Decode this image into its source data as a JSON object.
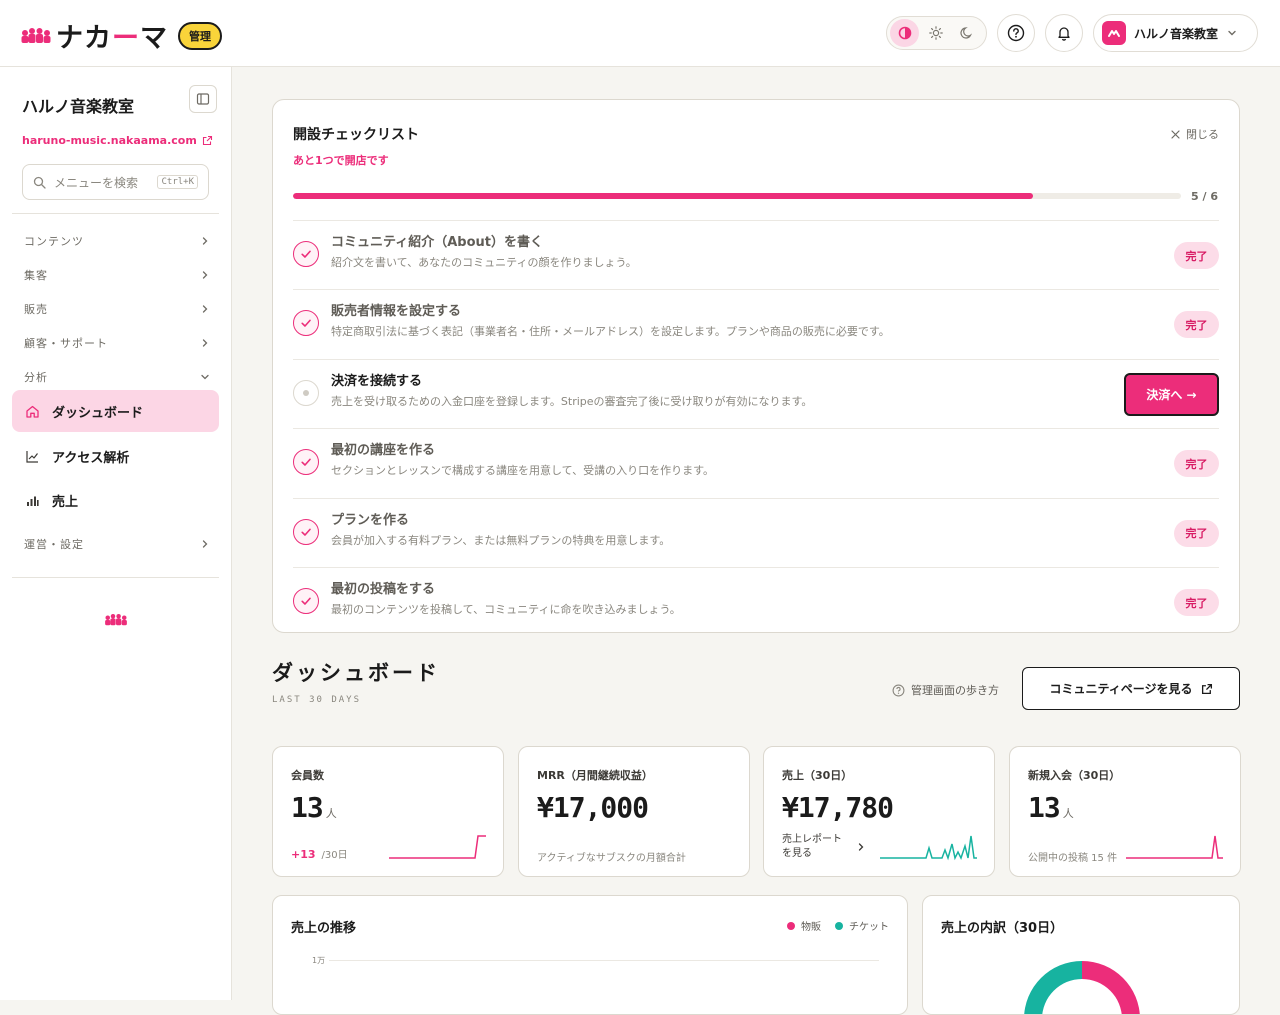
{
  "header": {
    "brand_wordmark_a": "ナカ",
    "brand_wordmark_dash": "ー",
    "brand_wordmark_b": "マ",
    "admin_badge": "管理",
    "account_name": "ハルノ音楽教室",
    "colors": {
      "accent": "#ec2d7a",
      "badge": "#f9d43a"
    },
    "icons": [
      "contrast-icon",
      "sun-icon",
      "moon-icon",
      "help-icon",
      "bell-icon",
      "chevron-down-icon"
    ]
  },
  "sidebar": {
    "title": "ハルノ音楽教室",
    "url": "haruno-music.nakaama.com",
    "search_placeholder": "メニューを検索",
    "search_shortcut": "Ctrl+K",
    "groups": {
      "content": "コンテンツ",
      "acquisition": "集客",
      "sales": "販売",
      "customers": "顧客・サポート",
      "analytics": "分析",
      "operations": "運営・設定"
    },
    "items": {
      "dashboard": "ダッシュボード",
      "access": "アクセス解析",
      "revenue": "売上"
    }
  },
  "checklist": {
    "title": "開設チェックリスト",
    "subtitle": "あと1つで開店です",
    "close_label": "閉じる",
    "progress_done": 5,
    "progress_total": 6,
    "progress_label": "5 / 6",
    "done_label": "完了",
    "cta_label": "決済へ →",
    "tasks": [
      {
        "title": "コミュニティ紹介（About）を書く",
        "desc": "紹介文を書いて、あなたのコミュニティの顔を作りましょう。",
        "done": true
      },
      {
        "title": "販売者情報を設定する",
        "desc": "特定商取引法に基づく表記（事業者名・住所・メールアドレス）を設定します。プランや商品の販売に必要です。",
        "done": true
      },
      {
        "title": "決済を接続する",
        "desc": "売上を受け取るための入金口座を登録します。Stripeの審査完了後に受け取りが有効になります。",
        "done": false
      },
      {
        "title": "最初の講座を作る",
        "desc": "セクションとレッスンで構成する講座を用意して、受講の入り口を作ります。",
        "done": true
      },
      {
        "title": "プランを作る",
        "desc": "会員が加入する有料プラン、または無料プランの特典を用意します。",
        "done": true
      },
      {
        "title": "最初の投稿をする",
        "desc": "最初のコンテンツを投稿して、コミュニティに命を吹き込みましょう。",
        "done": true
      }
    ]
  },
  "dashboard": {
    "title": "ダッシュボード",
    "range": "LAST 30 DAYS",
    "guide_link": "管理画面の歩き方",
    "community_button": "コミュニティページを見る",
    "stats": {
      "members": {
        "label": "会員数",
        "value": "13",
        "unit": "人",
        "delta": "+13",
        "delta_period": "/30日"
      },
      "mrr": {
        "label": "MRR（月間継続収益）",
        "value": "¥17,000",
        "foot": "アクティブなサブスクの月額合計"
      },
      "sales": {
        "label": "売上（30日）",
        "value": "¥17,780",
        "link": "売上レポートを見る"
      },
      "new_members": {
        "label": "新規入会（30日）",
        "value": "13",
        "unit": "人",
        "foot": "公開中の投稿 15 件"
      }
    },
    "trend_panel": {
      "title": "売上の推移",
      "legend": {
        "goods": "物販",
        "tickets": "チケット"
      },
      "colors": {
        "goods": "#ec2d7a",
        "tickets": "#17b3a0"
      },
      "ytick_top": "1万"
    },
    "breakdown_panel": {
      "title": "売上の内訳（30日）"
    }
  }
}
